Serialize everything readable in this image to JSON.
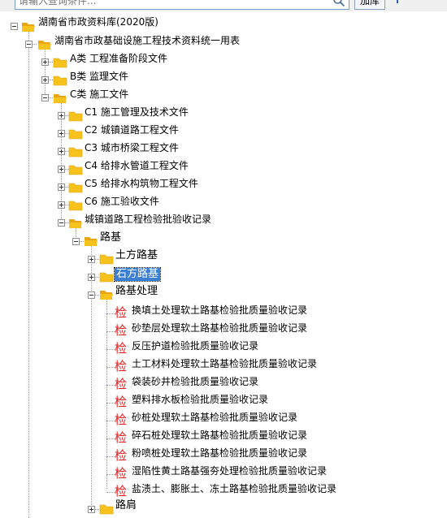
{
  "search": {
    "placeholder": "请输入查询条件...",
    "add_label": "加库"
  },
  "tree": {
    "root": "湖南省市政资料库(2020版)",
    "standard": "湖南省市政基础设施工程技术资料统一用表",
    "cat_a": "A类  工程准备阶段文件",
    "cat_b": "B类  监理文件",
    "cat_c": "C类  施工文件",
    "c1": "C1  施工管理及技术文件",
    "c2": "C2  城镇道路工程文件",
    "c3": "C3  城市桥梁工程文件",
    "c4": "C4  给排水管道工程文件",
    "c5": "C5  给排水构筑物工程文件",
    "c6": "C6  施工验收文件",
    "road_inspect": "城镇道路工程检验批验收记录",
    "roadbed": "路基",
    "earth_roadbed": "土方路基",
    "stone_roadbed": "石方路基",
    "roadbed_treatment": "路基处理",
    "doc_icon_char": "检",
    "records": [
      "换填土处理软土路基检验批质量验收记录",
      "砂垫层处理软土路基检验批质量验收记录",
      "反压护道检验批质量验收记录",
      "土工材料处理软土路基检验批质量验收记录",
      "袋装砂井检验批质量验收记录",
      "塑料排水板检验批质量验收记录",
      "砂桩处理软土路基检验批质量验收记录",
      "碎石桩处理软土路基检验批质量验收记录",
      "粉喷桩处理软土路基检验批质量验收记录",
      "湿陷性黄土路基强夯处理检验批质量验收记录",
      "盐渍土、膨胀土、冻土路基检验批质量验收记录"
    ],
    "shoulder": "路肩"
  },
  "colors": {
    "folder": "#f7c21c",
    "selection": "#3b7fd4",
    "doc_icon": "#e0201f"
  }
}
